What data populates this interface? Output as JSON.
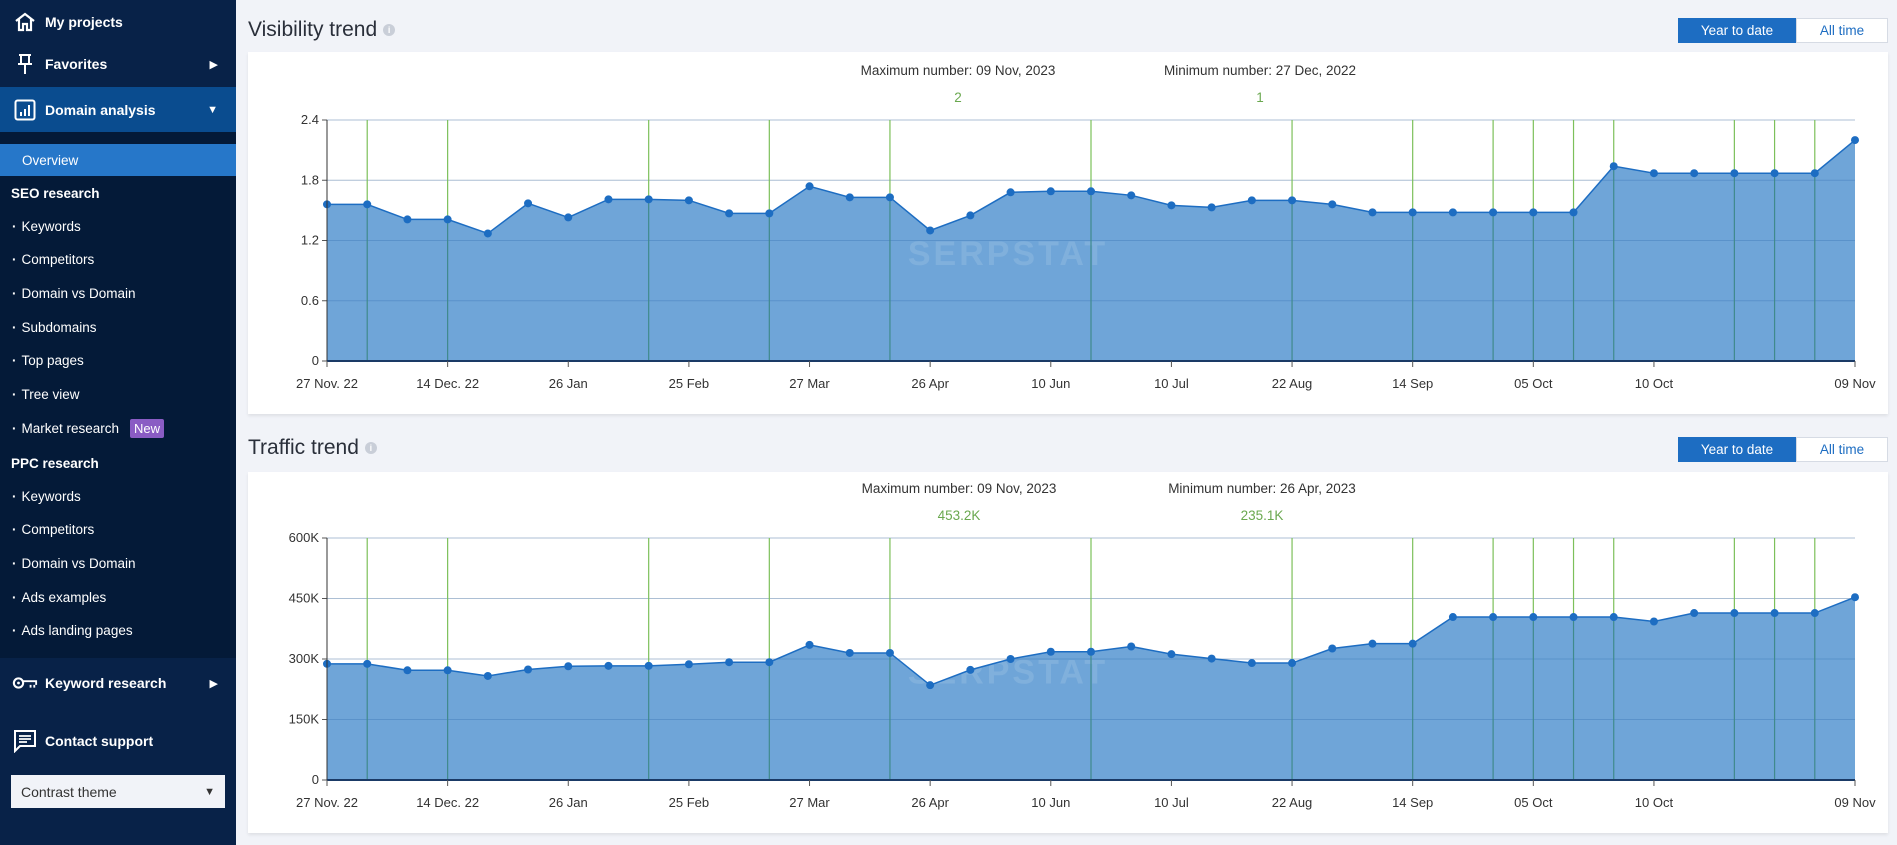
{
  "sidebar": {
    "top_items": [
      {
        "label": "My projects",
        "icon": "home-icon"
      },
      {
        "label": "Favorites",
        "icon": "pin-icon"
      },
      {
        "label": "Domain analysis",
        "icon": "chart-icon"
      }
    ],
    "overview_label": "Overview",
    "seo_heading": "SEO research",
    "seo_items": [
      "Keywords",
      "Competitors",
      "Domain vs Domain",
      "Subdomains",
      "Top pages",
      "Tree view",
      "Market research"
    ],
    "new_badge": "New",
    "ppc_heading": "PPC research",
    "ppc_items": [
      "Keywords",
      "Competitors",
      "Domain vs Domain",
      "Ads examples",
      "Ads landing pages"
    ],
    "keyword_research": "Keyword research",
    "contact_support": "Contact support",
    "theme_select": "Contrast theme"
  },
  "visibility": {
    "title": "Visibility trend",
    "toggle": {
      "active": "Year to date",
      "inactive": "All time"
    },
    "max_label": "Maximum number: 09 Nov, 2023",
    "max_value": "2",
    "min_label": "Minimum number: 27 Dec, 2022",
    "min_value": "1"
  },
  "traffic": {
    "title": "Traffic trend",
    "toggle": {
      "active": "Year to date",
      "inactive": "All time"
    },
    "max_label": "Maximum number: 09 Nov, 2023",
    "max_value": "453.2K",
    "min_label": "Minimum number: 26 Apr, 2023",
    "min_value": "235.1K"
  },
  "colors": {
    "area": "#6fa5d8",
    "line": "#1d6dc2",
    "marker": "#7cc05a",
    "accent": "#1d6dc2"
  },
  "watermark": "SERPSTAT",
  "chart_data": [
    {
      "type": "area",
      "title": "Visibility trend",
      "xlabel": "",
      "ylabel": "",
      "ylim": [
        0,
        2.4
      ],
      "yticks": [
        "0",
        "0.6",
        "1.2",
        "1.8",
        "2.4"
      ],
      "ytick_values": [
        0,
        0.6,
        1.2,
        1.8,
        2.4
      ],
      "xtick_labels": [
        "27 Nov. 22",
        "14 Dec. 22",
        "26 Jan",
        "25 Feb",
        "27 Mar",
        "26 Apr",
        "10 Jun",
        "10 Jul",
        "22 Aug",
        "14 Sep",
        "05 Oct",
        "10 Oct",
        "09 Nov"
      ],
      "xtick_index": [
        0,
        3,
        6,
        9,
        12,
        15,
        18,
        21,
        24,
        27,
        30,
        33,
        38
      ],
      "grid": true,
      "marker_index": [
        1,
        3,
        8,
        11,
        14,
        19,
        24,
        27,
        29,
        30,
        31,
        32,
        35,
        36,
        37
      ],
      "values": [
        1.56,
        1.56,
        1.41,
        1.41,
        1.27,
        1.57,
        1.43,
        1.61,
        1.61,
        1.6,
        1.47,
        1.47,
        1.74,
        1.63,
        1.63,
        1.3,
        1.45,
        1.68,
        1.69,
        1.69,
        1.65,
        1.55,
        1.53,
        1.6,
        1.6,
        1.56,
        1.48,
        1.48,
        1.48,
        1.48,
        1.48,
        1.48,
        1.94,
        1.87,
        1.87,
        1.87,
        1.87,
        1.87,
        2.2
      ]
    },
    {
      "type": "area",
      "title": "Traffic trend",
      "xlabel": "",
      "ylabel": "",
      "ylim": [
        0,
        600000
      ],
      "yticks": [
        "0",
        "150K",
        "300K",
        "450K",
        "600K"
      ],
      "ytick_values": [
        0,
        150000,
        300000,
        450000,
        600000
      ],
      "xtick_labels": [
        "27 Nov. 22",
        "14 Dec. 22",
        "26 Jan",
        "25 Feb",
        "27 Mar",
        "26 Apr",
        "10 Jun",
        "10 Jul",
        "22 Aug",
        "14 Sep",
        "05 Oct",
        "10 Oct",
        "09 Nov"
      ],
      "xtick_index": [
        0,
        3,
        6,
        9,
        12,
        15,
        18,
        21,
        24,
        27,
        30,
        33,
        38
      ],
      "grid": true,
      "marker_index": [
        1,
        3,
        8,
        11,
        14,
        19,
        24,
        27,
        29,
        30,
        31,
        32,
        35,
        36,
        37
      ],
      "values": [
        288000,
        288000,
        272000,
        272000,
        258000,
        274000,
        282000,
        283000,
        283000,
        287000,
        292000,
        292000,
        335000,
        315000,
        315000,
        235100,
        273000,
        300000,
        318000,
        318000,
        331000,
        312000,
        301000,
        290000,
        290000,
        326000,
        338000,
        338000,
        404000,
        404000,
        404000,
        404000,
        404000,
        393000,
        414000,
        414000,
        414000,
        414000,
        453200
      ]
    }
  ]
}
